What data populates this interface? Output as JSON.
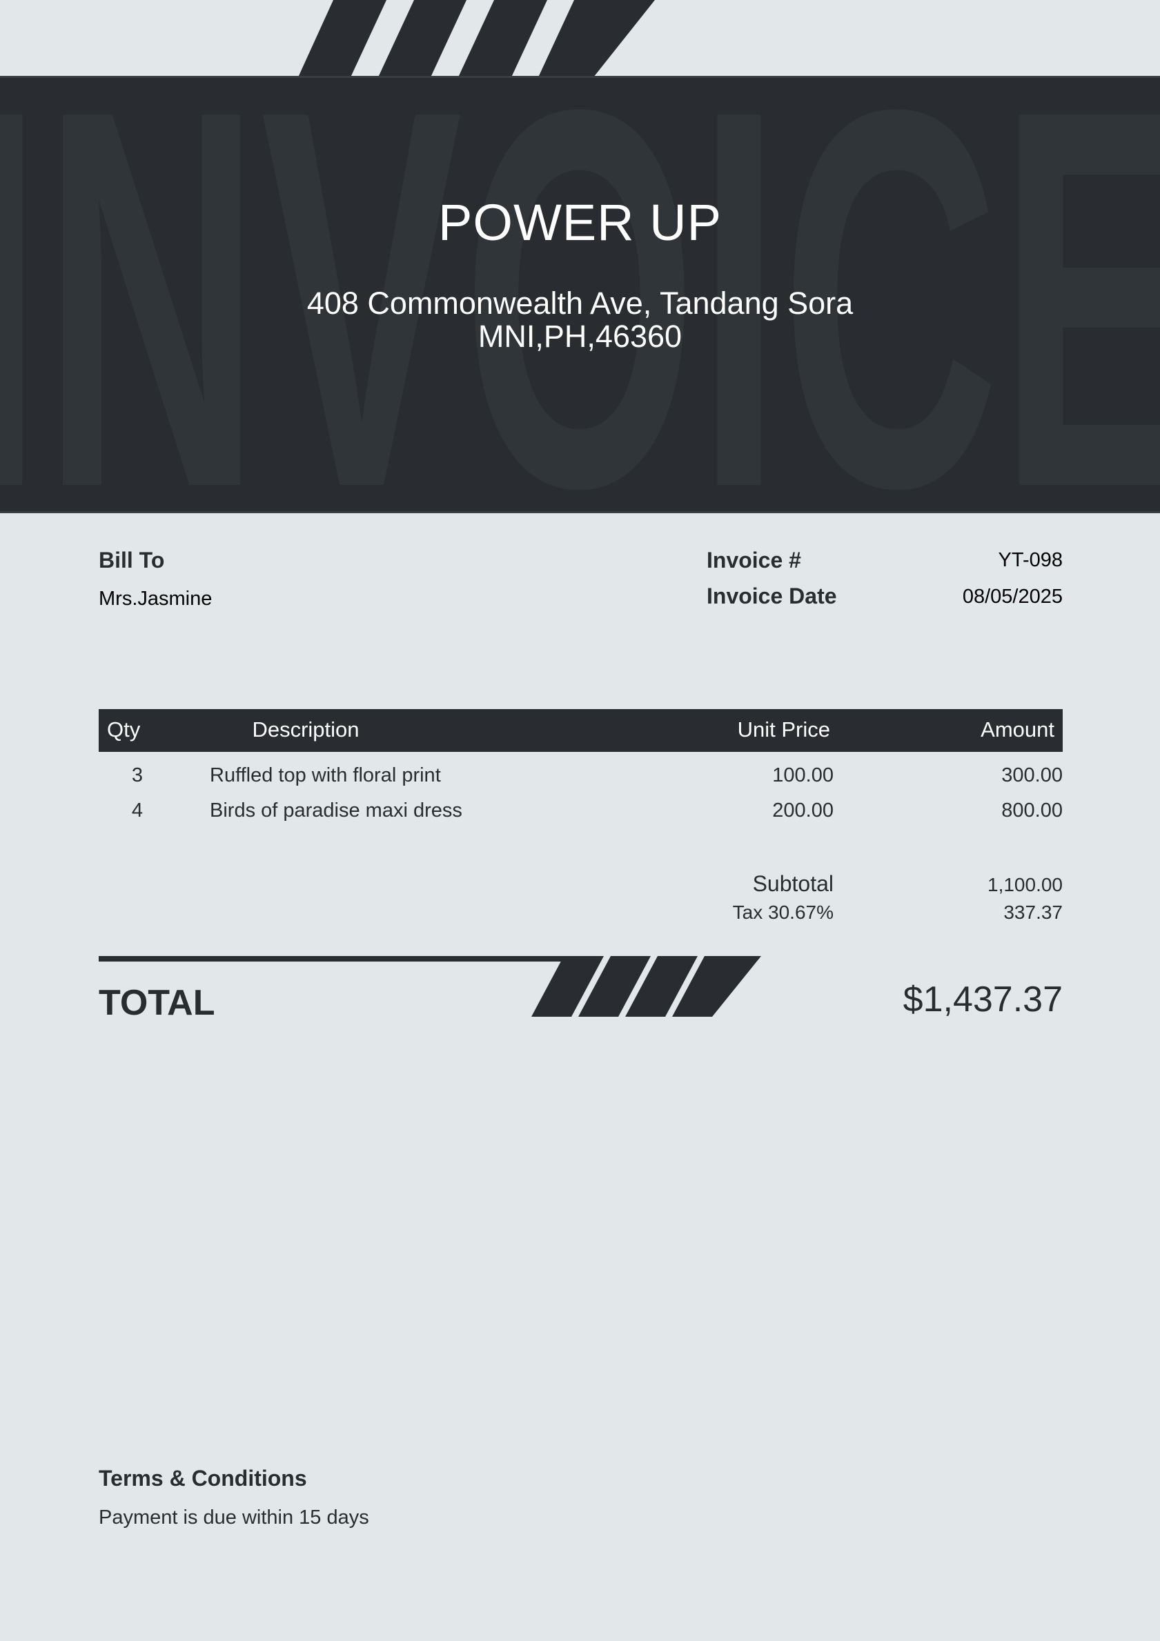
{
  "header": {
    "watermark": "INVOICE",
    "company_name": "POWER UP",
    "address_line1": "408 Commonwealth Ave, Tandang Sora",
    "address_line2": "MNI,PH,46360"
  },
  "bill_to": {
    "label": "Bill To",
    "name": "Mrs.Jasmine"
  },
  "invoice_meta": {
    "number_label": "Invoice #",
    "number_value": "YT-098",
    "date_label": "Invoice Date",
    "date_value": "08/05/2025"
  },
  "table": {
    "headers": {
      "qty": "Qty",
      "description": "Description",
      "unit_price": "Unit Price",
      "amount": "Amount"
    },
    "rows": [
      {
        "qty": "3",
        "description": "Ruffled top with floral print",
        "unit_price": "100.00",
        "amount": "300.00"
      },
      {
        "qty": "4",
        "description": "Birds of paradise maxi dress",
        "unit_price": "200.00",
        "amount": "800.00"
      }
    ]
  },
  "totals": {
    "subtotal_label": "Subtotal",
    "subtotal_value": "1,100.00",
    "tax_label": "Tax 30.67%",
    "tax_value": "337.37",
    "total_label": "TOTAL",
    "total_value": "$1,437.37"
  },
  "terms": {
    "title": "Terms & Conditions",
    "text": "Payment is due within 15 days"
  },
  "colors": {
    "background": "#e2e7ea",
    "dark": "#292c30",
    "watermark": "#30353a",
    "text": "#2a2d30"
  }
}
